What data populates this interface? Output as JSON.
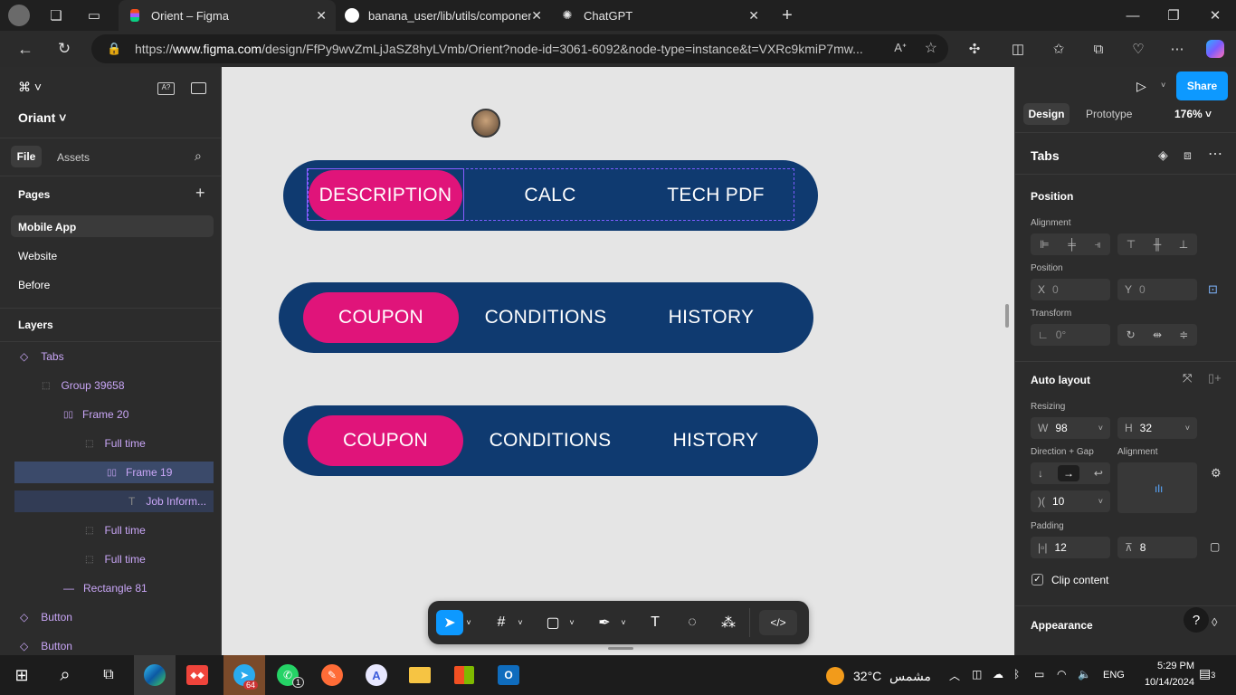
{
  "browser": {
    "tabs": [
      {
        "title": "Orient – Figma"
      },
      {
        "title": "banana_user/lib/utils/components"
      },
      {
        "title": "ChatGPT"
      }
    ],
    "url_prefix": "https://",
    "url_host": "www.figma.com",
    "url_path": "/design/FfPy9wvZmLjJaSZ8hyLVmb/Orient?node-id=3061-6092&node-type=instance&t=VXRc9kmiP7mw..."
  },
  "left_panel": {
    "project": "Oriant",
    "file_tab": "File",
    "assets_tab": "Assets",
    "pages_title": "Pages",
    "pages": [
      "Mobile App",
      "Website",
      "Before"
    ],
    "layers_title": "Layers",
    "layers": [
      {
        "label": "Tabs",
        "icon": "component-icon"
      },
      {
        "label": "Group 39658",
        "icon": "group-icon"
      },
      {
        "label": "Frame 20",
        "icon": "autolayout-icon"
      },
      {
        "label": "Full time",
        "icon": "frame-icon"
      },
      {
        "label": "Frame 19",
        "icon": "autolayout-icon"
      },
      {
        "label": "Job Inform...",
        "icon": "text-icon"
      },
      {
        "label": "Full time",
        "icon": "frame-icon"
      },
      {
        "label": "Full time",
        "icon": "frame-icon"
      },
      {
        "label": "Rectangle 81",
        "icon": "line-icon"
      },
      {
        "label": "Button",
        "icon": "component-icon"
      },
      {
        "label": "Button",
        "icon": "component-icon"
      }
    ]
  },
  "canvas": {
    "tab_groups": [
      {
        "tabs": [
          "DESCRIPTION",
          "CALC",
          "TECH PDF"
        ],
        "active": 0
      },
      {
        "tabs": [
          "COUPON",
          "CONDITIONS",
          "HISTORY"
        ],
        "active": 0
      },
      {
        "tabs": [
          "COUPON",
          "CONDITIONS",
          "HISTORY"
        ],
        "active": 0
      }
    ],
    "colors": {
      "background": "#e5e5e5",
      "pill": "#0f3a70",
      "active": "#e0147a"
    }
  },
  "right_panel": {
    "share": "Share",
    "design_tab": "Design",
    "prototype_tab": "Prototype",
    "zoom": "176%",
    "selection_name": "Tabs",
    "position_title": "Position",
    "alignment_label": "Alignment",
    "position_label": "Position",
    "x": {
      "k": "X",
      "v": "0"
    },
    "y": {
      "k": "Y",
      "v": "0"
    },
    "transform_label": "Transform",
    "rotation": "0°",
    "auto_layout_title": "Auto layout",
    "resizing_label": "Resizing",
    "w": {
      "k": "W",
      "v": "98"
    },
    "h": {
      "k": "H",
      "v": "32"
    },
    "direction_label": "Direction + Gap",
    "alignment2_label": "Alignment",
    "gap": "10",
    "padding_label": "Padding",
    "pad_h": "12",
    "pad_v": "8",
    "clip": "Clip content",
    "appearance": "Appearance"
  },
  "taskbar": {
    "weather_temp": "32°C",
    "weather_text": "مشمس",
    "lang": "ENG",
    "time": "5:29 PM",
    "date": "10/14/2024",
    "telegram_badge": "64",
    "whatsapp_badge": "1",
    "notif_badge": "3"
  }
}
